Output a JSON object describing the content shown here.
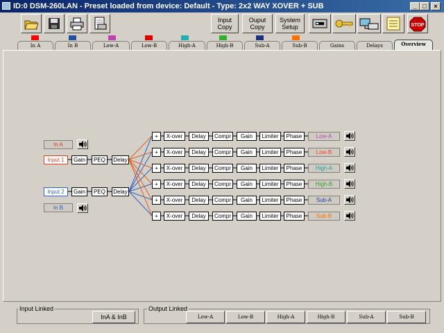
{
  "window": {
    "title": "ID:0 DSM-260LAN - Preset loaded from device: Default - Type: 2x2 WAY XOVER + SUB"
  },
  "toolbar": {
    "input_copy": [
      "Input",
      "Copy"
    ],
    "output_copy": [
      "Ouput",
      "Copy"
    ],
    "system_setup": [
      "System",
      "Setup"
    ],
    "stop_label": "STOP"
  },
  "tabs": [
    {
      "label": "In A",
      "color": "#ff0000"
    },
    {
      "label": "In B",
      "color": "#2050a0"
    },
    {
      "label": "Low-A",
      "color": "#c040b0"
    },
    {
      "label": "Low-B",
      "color": "#e00000"
    },
    {
      "label": "High-A",
      "color": "#20b0b0"
    },
    {
      "label": "High-B",
      "color": "#30b030"
    },
    {
      "label": "Sub-A",
      "color": "#203080"
    },
    {
      "label": "Sub-B",
      "color": "#ff7000"
    },
    {
      "label": "Gains",
      "color": ""
    },
    {
      "label": "Delays",
      "color": ""
    },
    {
      "label": "Overview",
      "color": ""
    }
  ],
  "overview": {
    "in_a": "In A",
    "in_b": "In B",
    "input_1": "Input 1",
    "input_2": "Input 2",
    "input_chain": [
      "Gain",
      "PEQ",
      "Delay"
    ],
    "sum": "+",
    "output_chain": [
      "X-over",
      "Delay",
      "Compr",
      "Gain",
      "Limiter",
      "Phase"
    ],
    "outputs": [
      {
        "label": "Low-A",
        "color": "#c040b0"
      },
      {
        "label": "Low-B",
        "color": "#ff4020"
      },
      {
        "label": "High-A",
        "color": "#20a0a0"
      },
      {
        "label": "High-B",
        "color": "#30a030"
      },
      {
        "label": "Sub-A",
        "color": "#2040a0"
      },
      {
        "label": "Sub-B",
        "color": "#ff7000"
      }
    ],
    "link_colors": {
      "from_input_1": "#e06020",
      "from_input_2": "#3060c0"
    }
  },
  "bottom": {
    "input_linked": "Input Linked",
    "output_linked": "Output Linked",
    "input_buttons": [
      "InA & InB"
    ],
    "output_buttons": [
      "Low-A",
      "Low-B",
      "High-A",
      "High-B",
      "Sub-A",
      "Sub-B"
    ]
  }
}
